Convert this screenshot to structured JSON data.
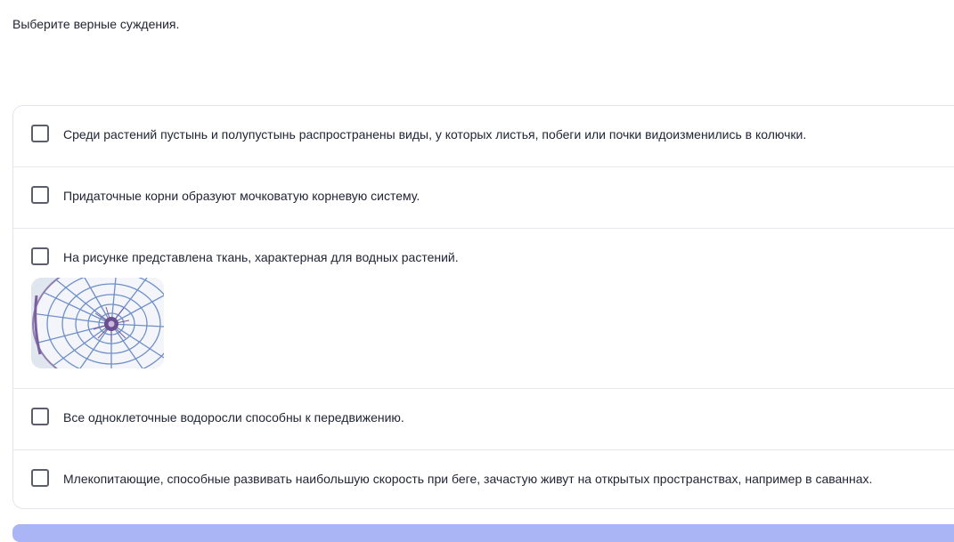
{
  "question": {
    "prompt": "Выберите верные суждения."
  },
  "options": [
    {
      "label": "Среди растений пустынь и полупустынь распространены виды, у которых листья, побеги или почки видоизменились в колючки.",
      "checked": false
    },
    {
      "label": "Придаточные корни образуют мочковатую корневую систему.",
      "checked": false
    },
    {
      "label": "На рисунке представлена ткань, характерная для водных растений.",
      "checked": false,
      "has_image": true
    },
    {
      "label": "Все одноклеточные водоросли способны к передвижению.",
      "checked": false
    },
    {
      "label": "Млекопитающие, способные развивать наибольшую скорость при беге, зачастую живут на открытых пространствах, например в саваннах.",
      "checked": false
    }
  ],
  "colors": {
    "text": "#1f2333",
    "checkbox_border": "#5b5f6b",
    "card_border": "#e3e5ec",
    "submit_bar": "#a9b5f5"
  },
  "icons": [
    "checkbox-icon",
    "tissue-micrograph-image"
  ]
}
